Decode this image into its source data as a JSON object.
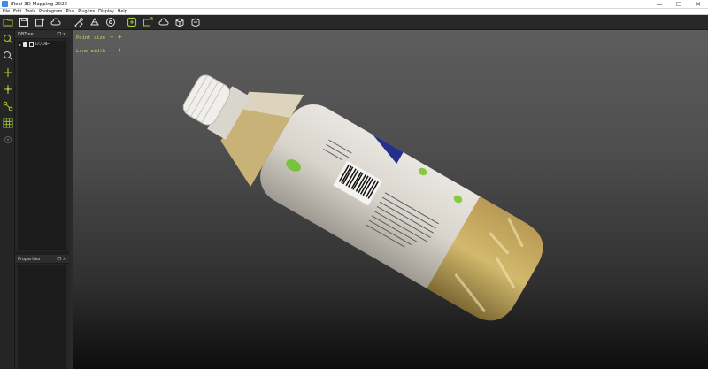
{
  "window": {
    "title": "iReal 3D Mapping 2022",
    "minimize": "—",
    "maximize": "☐",
    "close": "✕"
  },
  "menu": [
    "File",
    "Edit",
    "Tools",
    "Photogram",
    "Plus",
    "Plug-ins",
    "Display",
    "Help"
  ],
  "toolbar": {
    "icons": [
      "open-folder-icon",
      "save-icon",
      "import-images-icon",
      "cloud-icon",
      "clean-points-icon",
      "mesh-tool-icon",
      "target-icon",
      "texture-mapping-icon",
      "texture-sync-icon",
      "cloud-mesh-icon",
      "cube-export-icon",
      "cube-merge-icon"
    ]
  },
  "left_toolbar": {
    "icons": [
      "zoom-icon",
      "zoom-region-icon",
      "add-point-icon",
      "move-point-icon",
      "connect-points-icon",
      "grid-icon",
      "settings-icon"
    ]
  },
  "db_tree": {
    "title": "DBTree",
    "items": [
      {
        "label": "D:/Da─"
      }
    ]
  },
  "properties": {
    "title": "Properties"
  },
  "viewport": {
    "point_size_label": "Point size",
    "line_width_label": "Line width",
    "minus": "−",
    "plus": "+"
  },
  "colors": {
    "accent_yellow": "#c8d45a",
    "icon_green": "#a6c93a"
  }
}
